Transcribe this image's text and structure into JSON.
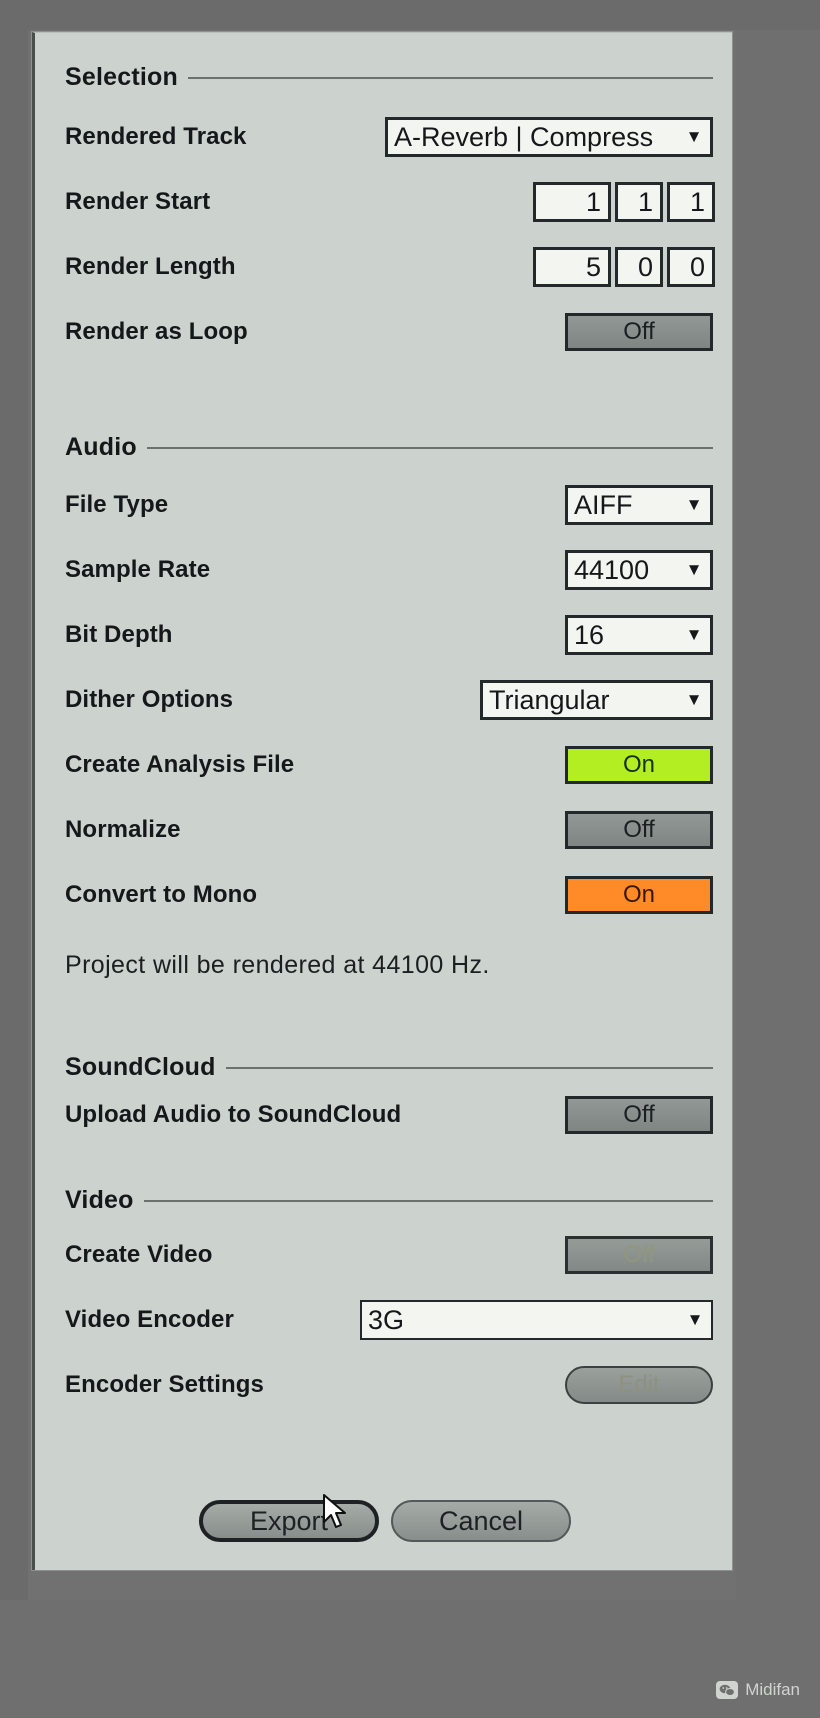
{
  "sections": {
    "selection": "Selection",
    "audio": "Audio",
    "soundcloud": "SoundCloud",
    "video": "Video"
  },
  "selection": {
    "rendered_track": {
      "label": "Rendered Track",
      "value": "A-Reverb | Compress",
      "arrow": "chevron-down-icon"
    },
    "render_start": {
      "label": "Render Start",
      "bars": "1",
      "beats": "1",
      "sixteenths": "1"
    },
    "render_length": {
      "label": "Render Length",
      "bars": "5",
      "beats": "0",
      "sixteenths": "0"
    },
    "render_as_loop": {
      "label": "Render as Loop",
      "value": "Off",
      "state": "off"
    }
  },
  "audio": {
    "file_type": {
      "label": "File Type",
      "value": "AIFF"
    },
    "sample_rate": {
      "label": "Sample Rate",
      "value": "44100"
    },
    "bit_depth": {
      "label": "Bit Depth",
      "value": "16"
    },
    "dither_options": {
      "label": "Dither Options",
      "value": "Triangular"
    },
    "create_analysis_file": {
      "label": "Create Analysis File",
      "value": "On",
      "state": "on-green"
    },
    "normalize": {
      "label": "Normalize",
      "value": "Off",
      "state": "off"
    },
    "convert_to_mono": {
      "label": "Convert to Mono",
      "value": "On",
      "state": "on-orange"
    },
    "note": "Project will be rendered at 44100 Hz."
  },
  "soundcloud": {
    "upload_audio": {
      "label": "Upload Audio to SoundCloud",
      "value": "Off",
      "state": "off"
    }
  },
  "video": {
    "create_video": {
      "label": "Create Video",
      "value": "Off",
      "state": "off-disabled"
    },
    "video_encoder": {
      "label": "Video Encoder",
      "value": "3G"
    },
    "encoder_settings": {
      "label": "Encoder Settings",
      "value": "Edit"
    }
  },
  "buttons": {
    "export": "Export",
    "cancel": "Cancel"
  },
  "watermark": {
    "text": "Midifan"
  },
  "colors": {
    "dialog_bg": "#ccd2cd",
    "on_green": "#b2ee22",
    "on_orange": "#ff8b28",
    "off_gray": "#8b918e",
    "field_bg": "#f3f5f0",
    "border": "#23282a",
    "window_chrome": "#6f6f6f"
  }
}
